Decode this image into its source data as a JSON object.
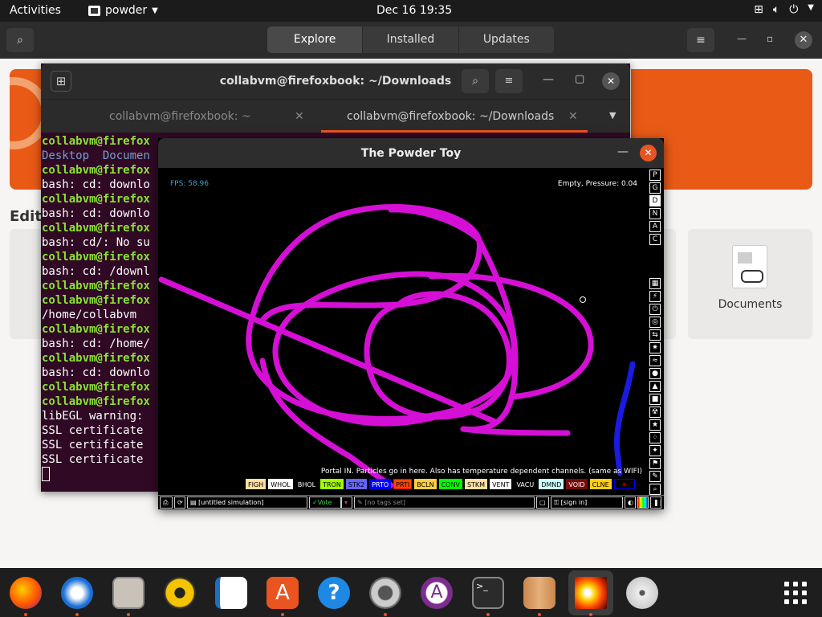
{
  "topbar": {
    "activities": "Activities",
    "app_name": "powder",
    "clock": "Dec 16  19:35"
  },
  "software": {
    "tabs": [
      {
        "label": "Explore",
        "active": true
      },
      {
        "label": "Installed",
        "active": false
      },
      {
        "label": "Updates",
        "active": false
      }
    ],
    "section_label": "Edit",
    "card_label": "Documents",
    "banner_color": "#e95a17"
  },
  "terminal": {
    "title": "collabvm@firefoxbook: ~/Downloads",
    "tabs": [
      {
        "label": "collabvm@firefoxbook: ~",
        "active": false
      },
      {
        "label": "collabvm@firefoxbook: ~/Downloads",
        "active": true
      }
    ],
    "lines": [
      {
        "text": "collabvm@firefox",
        "color": "g"
      },
      {
        "text": "Desktop  Documen",
        "color": "b"
      },
      {
        "text": "collabvm@firefox",
        "color": "g"
      },
      {
        "text": "bash: cd: downlo",
        "color": "w"
      },
      {
        "text": "collabvm@firefox",
        "color": "g"
      },
      {
        "text": "bash: cd: downlo",
        "color": "w"
      },
      {
        "text": "collabvm@firefox",
        "color": "g"
      },
      {
        "text": "bash: cd/: No su",
        "color": "w"
      },
      {
        "text": "collabvm@firefox",
        "color": "g"
      },
      {
        "text": "bash: cd: /downl",
        "color": "w"
      },
      {
        "text": "collabvm@firefox",
        "color": "g"
      },
      {
        "text": "collabvm@firefox",
        "color": "g"
      },
      {
        "text": "/home/collabvm",
        "color": "w"
      },
      {
        "text": "collabvm@firefox",
        "color": "g"
      },
      {
        "text": "bash: cd: /home/",
        "color": "w"
      },
      {
        "text": "collabvm@firefox",
        "color": "g"
      },
      {
        "text": "bash: cd: downlo",
        "color": "w"
      },
      {
        "text": "collabvm@firefox",
        "color": "g"
      },
      {
        "text": "collabvm@firefox",
        "color": "g"
      },
      {
        "text": "libEGL warning: ",
        "color": "w"
      },
      {
        "text": "SSL certificate ",
        "color": "w"
      },
      {
        "text": "SSL certificate ",
        "color": "w"
      },
      {
        "text": "SSL certificate ",
        "color": "w"
      }
    ]
  },
  "powder": {
    "title": "The Powder Toy",
    "fps": "FPS: 58.96",
    "pressure": "Empty, Pressure: 0.04",
    "description": "Portal IN. Particles go in here. Also has temperature dependent channels. (same as WIFI)",
    "menu_letters": [
      "P",
      "G",
      "D",
      "N",
      "A",
      "C"
    ],
    "elements": [
      {
        "label": "FIGH",
        "bg": "#ffe0a0",
        "fg": "#000"
      },
      {
        "label": "WHOL",
        "bg": "#ffffff",
        "fg": "#000"
      },
      {
        "label": "BHOL",
        "bg": "#000000",
        "fg": "#fff"
      },
      {
        "label": "TRON",
        "bg": "#a0ff00",
        "fg": "#000"
      },
      {
        "label": "STK2",
        "bg": "#6464ff",
        "fg": "#000"
      },
      {
        "label": "PRTO",
        "bg": "#0000ff",
        "fg": "#fff"
      },
      {
        "label": "PRTI",
        "bg": "#ff4400",
        "fg": "#000"
      },
      {
        "label": "BCLN",
        "bg": "#ffd040",
        "fg": "#000"
      },
      {
        "label": "CONV",
        "bg": "#00ff00",
        "fg": "#000"
      },
      {
        "label": "STKM",
        "bg": "#ffe0a0",
        "fg": "#000"
      },
      {
        "label": "VENT",
        "bg": "#ffffff",
        "fg": "#000"
      },
      {
        "label": "VACU",
        "bg": "#000000",
        "fg": "#fff"
      },
      {
        "label": "DMND",
        "bg": "#ccffff",
        "fg": "#000"
      },
      {
        "label": "VOID",
        "bg": "#790b0b",
        "fg": "#fff"
      },
      {
        "label": "CLNE",
        "bg": "#ffd010",
        "fg": "#000"
      },
      {
        "label": "✕",
        "bg": "#000000",
        "fg": "#f00"
      }
    ],
    "save_name": "[untitled simulation]",
    "vote": "Vote",
    "tags": "[no tags set]",
    "sign_in": "[sign in]"
  }
}
